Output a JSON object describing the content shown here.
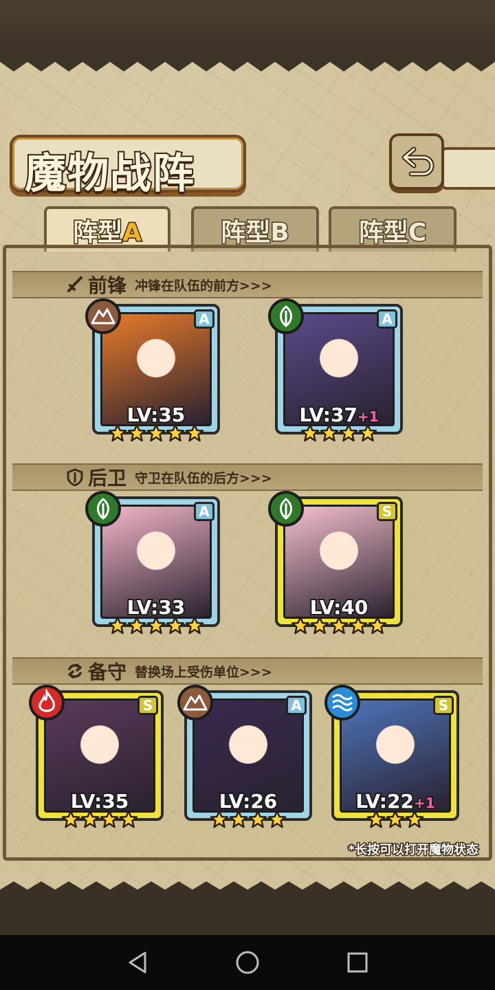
{
  "title": "魔物战阵",
  "tabs": [
    {
      "label": "阵型",
      "letter": "A",
      "active": true
    },
    {
      "label": "阵型",
      "letter": "B",
      "active": false
    },
    {
      "label": "阵型",
      "letter": "C",
      "active": false
    }
  ],
  "sections": [
    {
      "title": "前锋",
      "desc": "冲锋在队伍的前方>>>",
      "icon": "sword-icon"
    },
    {
      "title": "后卫",
      "desc": "守卫在队伍的后方>>>",
      "icon": "shield-icon"
    },
    {
      "title": "备守",
      "desc": "替换场上受伤单位>>>",
      "icon": "swap-icon"
    }
  ],
  "cards": [
    {
      "rank": "A",
      "element": "earth",
      "level": "LV:35",
      "plus": "",
      "stars": 5,
      "color": "#e87a2a"
    },
    {
      "rank": "A",
      "element": "wood",
      "level": "LV:37",
      "plus": "+1",
      "stars": 4,
      "color": "#5b4a8a"
    },
    {
      "rank": "A",
      "element": "wood",
      "level": "LV:33",
      "plus": "",
      "stars": 5,
      "color": "#f3b6c9"
    },
    {
      "rank": "S",
      "element": "wood",
      "level": "LV:40",
      "plus": "",
      "stars": 5,
      "color": "#f6c0cf"
    },
    {
      "rank": "S",
      "element": "fire",
      "level": "LV:35",
      "plus": "",
      "stars": 4,
      "color": "#5a3a5a"
    },
    {
      "rank": "A",
      "element": "earth",
      "level": "LV:26",
      "plus": "",
      "stars": 4,
      "color": "#3a2a4e"
    },
    {
      "rank": "S",
      "element": "water",
      "level": "LV:22",
      "plus": "+1",
      "stars": 3,
      "color": "#4d73b8"
    }
  ],
  "element_colors": {
    "earth": "#8c5a3c",
    "wood": "#2f7a2a",
    "fire": "#d42a2a",
    "water": "#2a8cd4"
  },
  "hint": "*长按可以打开魔物状态"
}
